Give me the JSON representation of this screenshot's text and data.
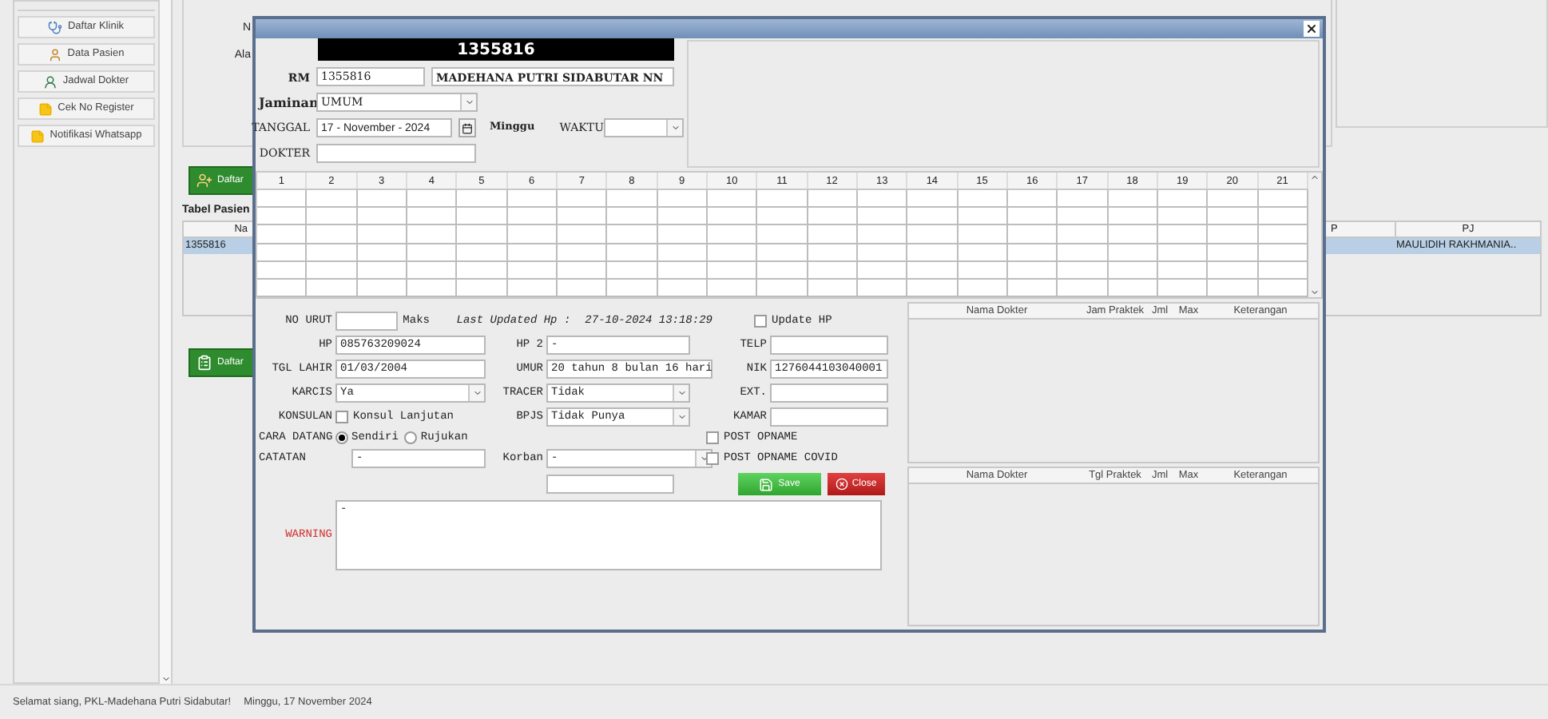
{
  "sidebar": {
    "items": [
      {
        "label": "Daftar Klinik",
        "kind": "clinic"
      },
      {
        "label": "Data Pasien",
        "kind": "patient"
      },
      {
        "label": "Jadwal Dokter",
        "kind": "doctor"
      },
      {
        "label": "Cek No Register",
        "kind": "note"
      },
      {
        "label": "Notifikasi Whatsapp",
        "kind": "note"
      }
    ]
  },
  "background": {
    "labels": [
      "N",
      "Ala"
    ],
    "buttons": [
      {
        "label": "Daftar",
        "kind": "patient"
      },
      {
        "label": "Daftar",
        "kind": "clipboard"
      }
    ],
    "table_title": "Tabel Pasien",
    "table": {
      "columns": [
        "Na",
        "P",
        "PJ"
      ],
      "rows": [
        {
          "selected": true,
          "first": "1355816",
          "last": "MAULIDIH RAKHMANIA.."
        }
      ]
    }
  },
  "dialog": {
    "banner": "1355816",
    "rm_label": "RM",
    "rm": "1355816",
    "name": "MADEHANA PUTRI SIDABUTAR NN",
    "jaminan_label": "Jaminan",
    "jaminan": "UMUM",
    "tanggal_label": "TANGGAL",
    "tanggal": "17 - November - 2024",
    "day": "Minggu",
    "waktu_label": "WAKTU",
    "dokter_label": "DOKTER",
    "schedule": {
      "columns": [
        "1",
        "2",
        "3",
        "4",
        "5",
        "6",
        "7",
        "8",
        "9",
        "10",
        "11",
        "12",
        "13",
        "14",
        "15",
        "16",
        "17",
        "18",
        "19",
        "20",
        "21"
      ]
    },
    "form": {
      "no_urut": "NO URUT",
      "maks": "Maks",
      "last_updated_label": "Last Updated Hp :",
      "last_updated": "27-10-2024 13:18:29",
      "update_hp": {
        "label": "Update HP",
        "checked": false
      },
      "hp": {
        "label": "HP",
        "value": "085763209024"
      },
      "hp2": {
        "label": "HP 2",
        "value": "-"
      },
      "telp": {
        "label": "TELP"
      },
      "tgl_lahir": {
        "label": "TGL LAHIR",
        "value": "01/03/2004"
      },
      "umur": {
        "label": "UMUR",
        "value": "20 tahun 8 bulan 16 hari"
      },
      "nik": {
        "label": "NIK",
        "value": "1276044103040001"
      },
      "karcis": {
        "label": "KARCIS",
        "value": "Ya"
      },
      "tracer": {
        "label": "TRACER",
        "value": "Tidak"
      },
      "ext": {
        "label": "EXT."
      },
      "konsulan": {
        "label": "KONSULAN",
        "checkbox": "Konsul Lanjutan",
        "checked": false
      },
      "bpjs": {
        "label": "BPJS",
        "value": "Tidak Punya"
      },
      "kamar": {
        "label": "KAMAR"
      },
      "post_opname": {
        "label": "POST OPNAME",
        "checked": false
      },
      "cara_datang": {
        "label": "CARA DATANG",
        "options": [
          {
            "label": "Sendiri",
            "selected": true
          },
          {
            "label": "Rujukan",
            "selected": false
          }
        ]
      },
      "catatan": {
        "label": "CATATAN",
        "value": "-"
      },
      "korban": {
        "label": "Korban",
        "value": "-"
      },
      "post_opname_covid": {
        "label": "POST OPNAME COVID",
        "checked": false
      },
      "save": "Save",
      "close": "Close",
      "warning": {
        "label": "WARNING",
        "value": "-"
      }
    },
    "doctor_tables": [
      {
        "columns": [
          "Nama Dokter",
          "Jam Praktek",
          "Jml",
          "Max",
          "Keterangan"
        ]
      },
      {
        "columns": [
          "Nama Dokter",
          "Tgl Praktek",
          "Jml",
          "Max",
          "Keterangan"
        ]
      }
    ]
  },
  "status_bar": {
    "greeting": "Selamat siang, PKL-Madehana Putri Sidabutar!",
    "date": "Minggu, 17 November 2024"
  }
}
